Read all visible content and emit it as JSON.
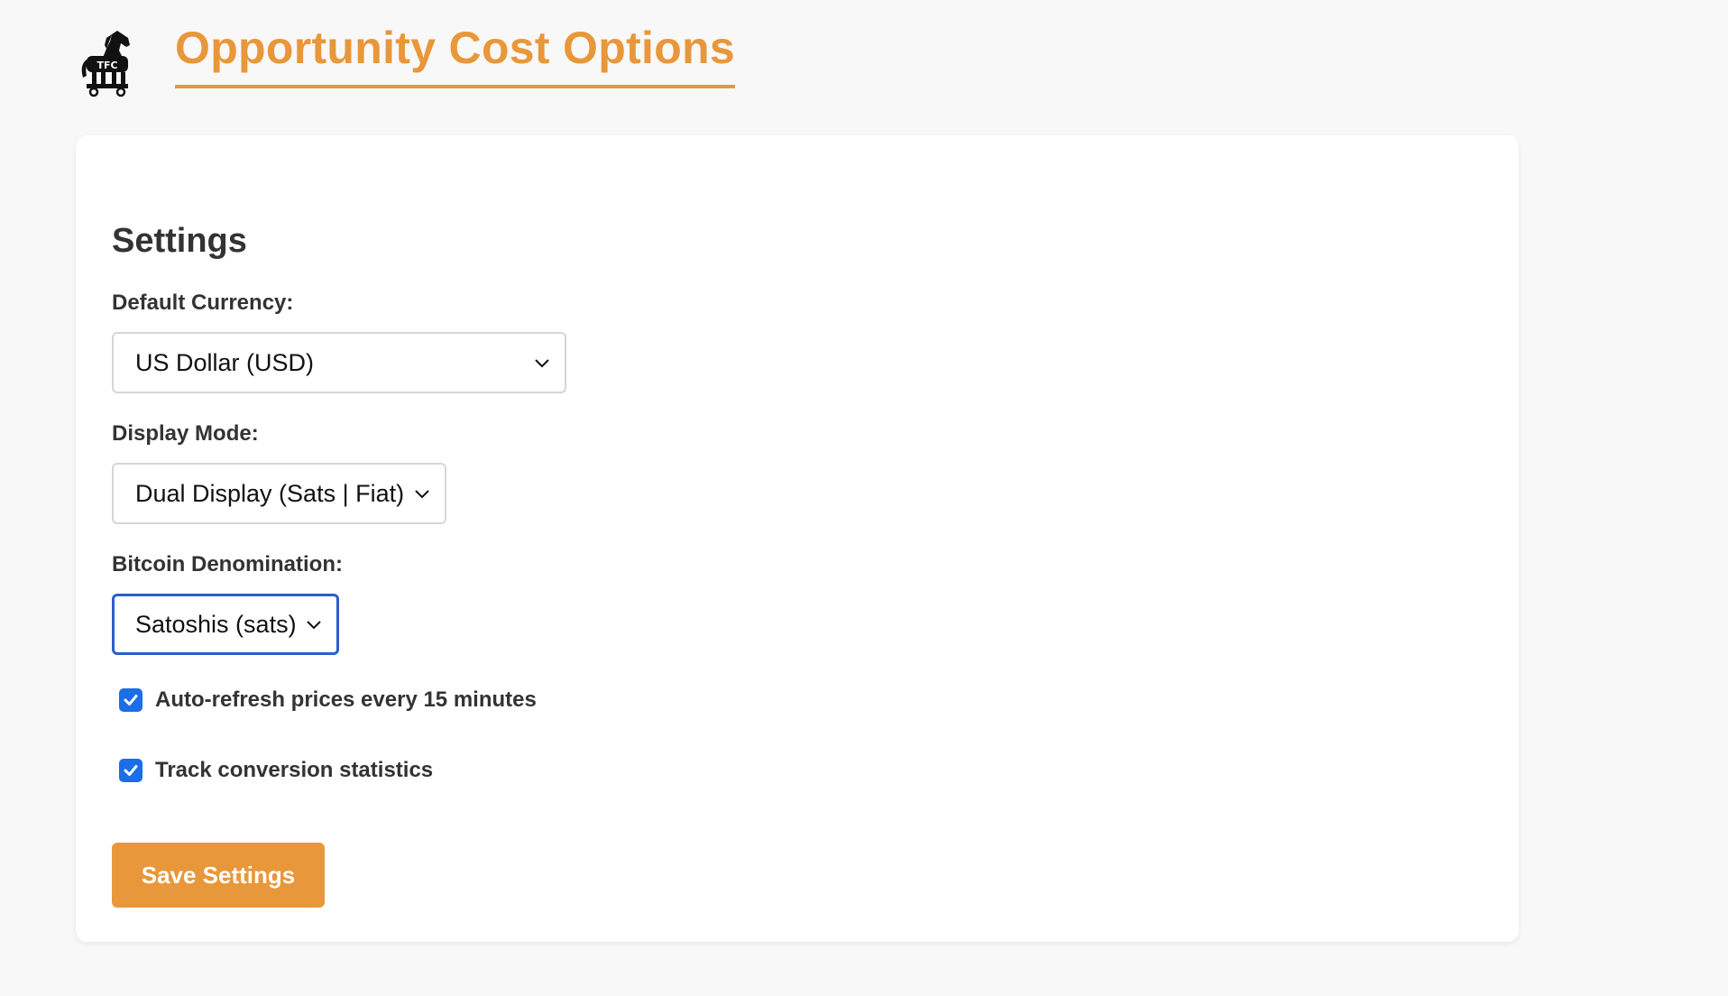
{
  "header": {
    "title": "Opportunity Cost Options",
    "logo_icon": "trojan-horse-logo-icon",
    "accent_color": "#e8973a"
  },
  "settings": {
    "title": "Settings",
    "currency": {
      "label": "Default Currency:",
      "value": "US Dollar (USD)"
    },
    "display_mode": {
      "label": "Display Mode:",
      "value": "Dual Display (Sats | Fiat)"
    },
    "denomination": {
      "label": "Bitcoin Denomination:",
      "value": "Satoshis (sats)"
    },
    "auto_refresh": {
      "label": "Auto-refresh prices every 15 minutes",
      "checked": true
    },
    "track_stats": {
      "label": "Track conversion statistics",
      "checked": true
    },
    "save_label": "Save Settings"
  }
}
